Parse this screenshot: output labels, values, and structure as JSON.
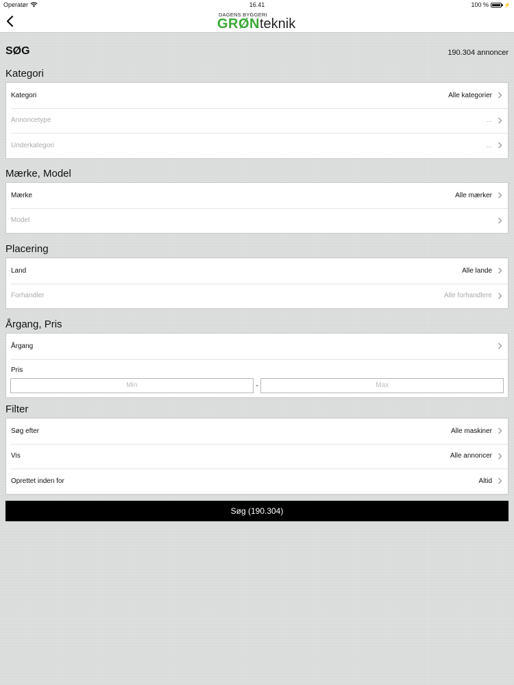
{
  "status_bar": {
    "carrier": "Operatør",
    "time": "16.41",
    "battery": "100 %"
  },
  "nav": {
    "logo_top": "DAGENS BYGGERI",
    "logo_green": "GRØN",
    "logo_dark": "teknik"
  },
  "header": {
    "title": "SØG",
    "count": "190.304 annoncer"
  },
  "sections": {
    "kategori": {
      "title": "Kategori",
      "rows": [
        {
          "label": "Kategori",
          "value": "Alle kategorier"
        },
        {
          "label": "Annoncetype",
          "value": "..."
        },
        {
          "label": "Underkategori",
          "value": "..."
        }
      ]
    },
    "maerke": {
      "title": "Mærke, Model",
      "rows": [
        {
          "label": "Mærke",
          "value": "Alle mærker"
        },
        {
          "label": "Model",
          "value": ""
        }
      ]
    },
    "placering": {
      "title": "Placering",
      "rows": [
        {
          "label": "Land",
          "value": "Alle lande"
        },
        {
          "label": "Forhandler",
          "value": "Alle forhandlere"
        }
      ]
    },
    "aargang": {
      "title": "Årgang, Pris",
      "year_label": "Årgang",
      "price_label": "Pris",
      "min_placeholder": "Min",
      "max_placeholder": "Max",
      "dash": "-"
    },
    "filter": {
      "title": "Filter",
      "rows": [
        {
          "label": "Søg efter",
          "value": "Alle maskiner"
        },
        {
          "label": "Vis",
          "value": "Alle annoncer"
        },
        {
          "label": "Oprettet inden for",
          "value": "Altid"
        }
      ]
    }
  },
  "search_button": "Søg (190.304)",
  "icons": {
    "back": "chevron-left-icon",
    "row": "chevron-right-icon",
    "wifi": "wifi-icon",
    "battery": "battery-icon"
  },
  "colors": {
    "brand_green": "#3aa935",
    "button_bg": "#000000",
    "background": "#dcdddd"
  }
}
